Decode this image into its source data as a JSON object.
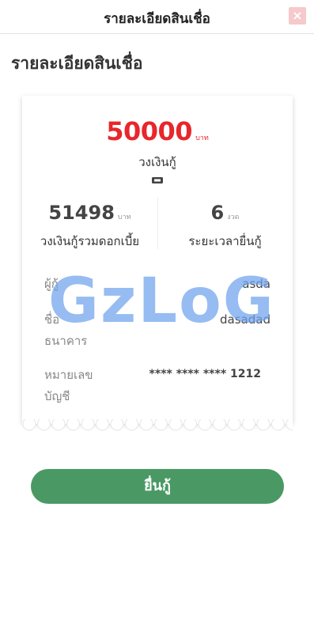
{
  "header": {
    "title": "รายละเอียดสินเชื่อ",
    "close_label": "×"
  },
  "page": {
    "heading": "รายละเอียดสินเชื่อ"
  },
  "loan": {
    "amount": "50000",
    "amount_unit": "บาท",
    "amount_label": "วงเงินกู้",
    "total_amount": "51498",
    "total_unit": "บาท",
    "total_label": "วงเงินกู้รวมดอกเบี้ย",
    "term": "6",
    "term_unit": "งวด",
    "term_label": "ระยะเวลายื่นกู้"
  },
  "details": {
    "borrower_label": "ผู้กู้",
    "borrower_value": "asda",
    "bank_label_line1": "ชื่อ",
    "bank_label_line2": "ธนาคาร",
    "bank_value": "dasadad",
    "account_label_line1": "หมายเลข",
    "account_label_line2": "บัญชี",
    "account_value": "**** **** **** 1212"
  },
  "watermark": "GzLoG",
  "actions": {
    "apply_label": "ยื่นกู้"
  },
  "colors": {
    "amount": "#e8262b",
    "button": "#4a9964",
    "watermark": "#6ea3ee"
  }
}
